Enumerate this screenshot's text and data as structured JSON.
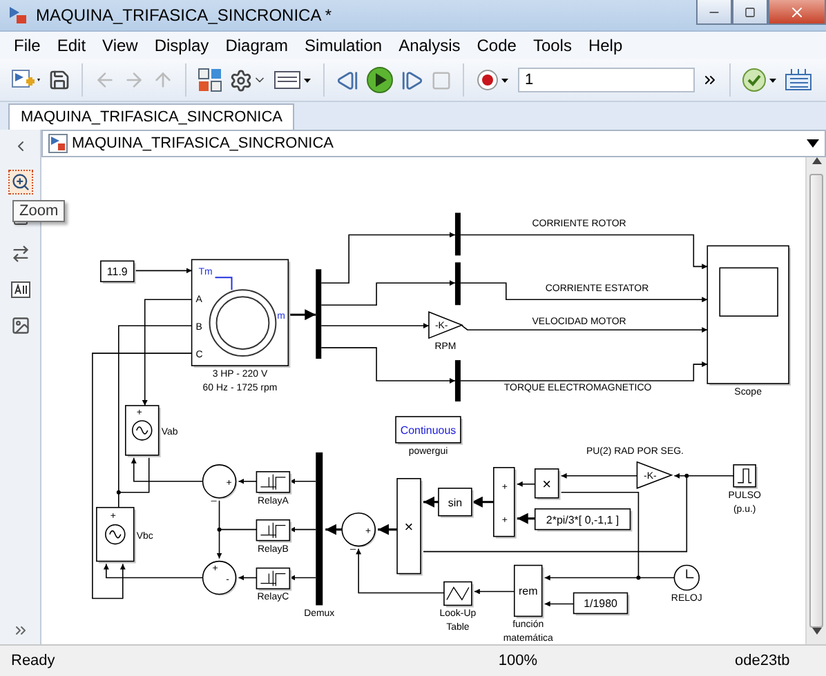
{
  "window": {
    "title": "MAQUINA_TRIFASICA_SINCRONICA *"
  },
  "menu": [
    "File",
    "Edit",
    "View",
    "Display",
    "Diagram",
    "Simulation",
    "Analysis",
    "Code",
    "Tools",
    "Help"
  ],
  "toolbar": {
    "stop_time": "1"
  },
  "tabs": [
    {
      "label": "MAQUINA_TRIFASICA_SINCRONICA",
      "selected": true
    }
  ],
  "breadcrumb": "MAQUINA_TRIFASICA_SINCRONICA",
  "tooltip": "Zoom",
  "blocks": [
    {
      "kind": "constant",
      "text": "11.9"
    },
    {
      "kind": "machine",
      "ports": [
        "Tm",
        "A",
        "B",
        "C",
        "m"
      ],
      "label": [
        "3 HP - 220 V",
        "60 Hz - 1725 rpm"
      ]
    },
    {
      "kind": "bus"
    },
    {
      "kind": "bus"
    },
    {
      "kind": "bus"
    },
    {
      "kind": "gain",
      "text": "-K-",
      "label": [
        "RPM"
      ]
    },
    {
      "kind": "bus"
    },
    {
      "kind": "scope",
      "label": [
        "Scope"
      ]
    },
    {
      "kind": "powergui",
      "text": "Continuous",
      "label": [
        "powergui"
      ]
    },
    {
      "kind": "source",
      "signs": [
        "+"
      ],
      "label": [
        "Vab"
      ]
    },
    {
      "kind": "source",
      "signs": [
        "+"
      ],
      "label": [
        "Vbc"
      ]
    },
    {
      "kind": "sum",
      "signs": [
        "+",
        "_"
      ]
    },
    {
      "kind": "sum",
      "signs": [
        "+",
        "-"
      ]
    },
    {
      "kind": "relay",
      "label": [
        "RelayA"
      ]
    },
    {
      "kind": "relay",
      "label": [
        "RelayB"
      ]
    },
    {
      "kind": "relay",
      "label": [
        "RelayC"
      ]
    },
    {
      "kind": "bus",
      "label": [
        "Demux"
      ]
    },
    {
      "kind": "sum",
      "signs": [
        "+",
        "_"
      ]
    },
    {
      "kind": "product",
      "text": "×"
    },
    {
      "kind": "function",
      "text": "sin"
    },
    {
      "kind": "sum_rect",
      "signs": [
        "+",
        "+"
      ]
    },
    {
      "kind": "product",
      "text": "×"
    },
    {
      "kind": "constant",
      "text": "2*pi/3*[ 0,-1,1 ]"
    },
    {
      "kind": "gain",
      "text": "-K-",
      "label": [
        "PU(2) RAD POR SEG."
      ]
    },
    {
      "kind": "pulse",
      "label": [
        "PULSO",
        "(p.u.)"
      ]
    },
    {
      "kind": "function",
      "text": "rem",
      "label": [
        "función",
        "matemática"
      ]
    },
    {
      "kind": "clock",
      "label": [
        "RELOJ"
      ]
    },
    {
      "kind": "constant",
      "text": "1/1980"
    },
    {
      "kind": "lookup",
      "label": [
        "Look-Up",
        "Table"
      ]
    }
  ],
  "signal_labels": [
    "CORRIENTE ROTOR",
    "CORRIENTE ESTATOR",
    "VELOCIDAD MOTOR",
    "TORQUE ELECTROMAGNETICO"
  ],
  "status_bar": {
    "state": "Ready",
    "zoom": "100%",
    "solver": "ode23tb"
  }
}
